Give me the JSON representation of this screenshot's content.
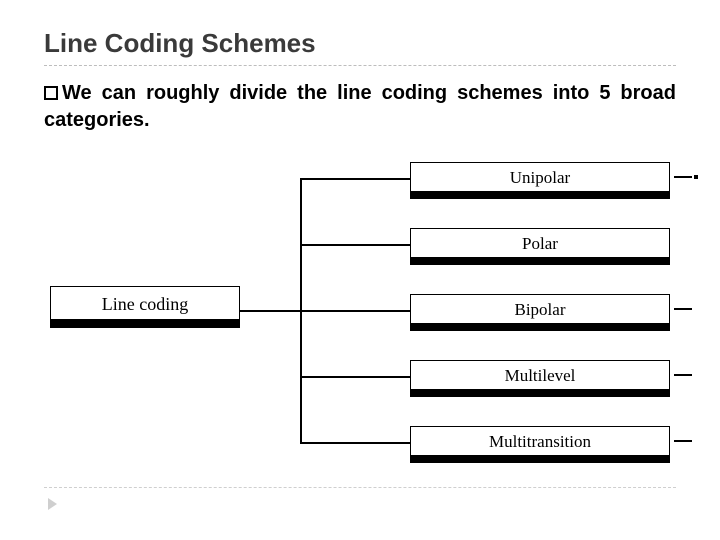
{
  "title": "Line Coding Schemes",
  "body": {
    "lead": "We",
    "rest": " can roughly divide the line coding schemes into 5 broad categories."
  },
  "diagram": {
    "root": "Line coding",
    "categories": [
      "Unipolar",
      "Polar",
      "Bipolar",
      "Multilevel",
      "Multitransition"
    ]
  }
}
